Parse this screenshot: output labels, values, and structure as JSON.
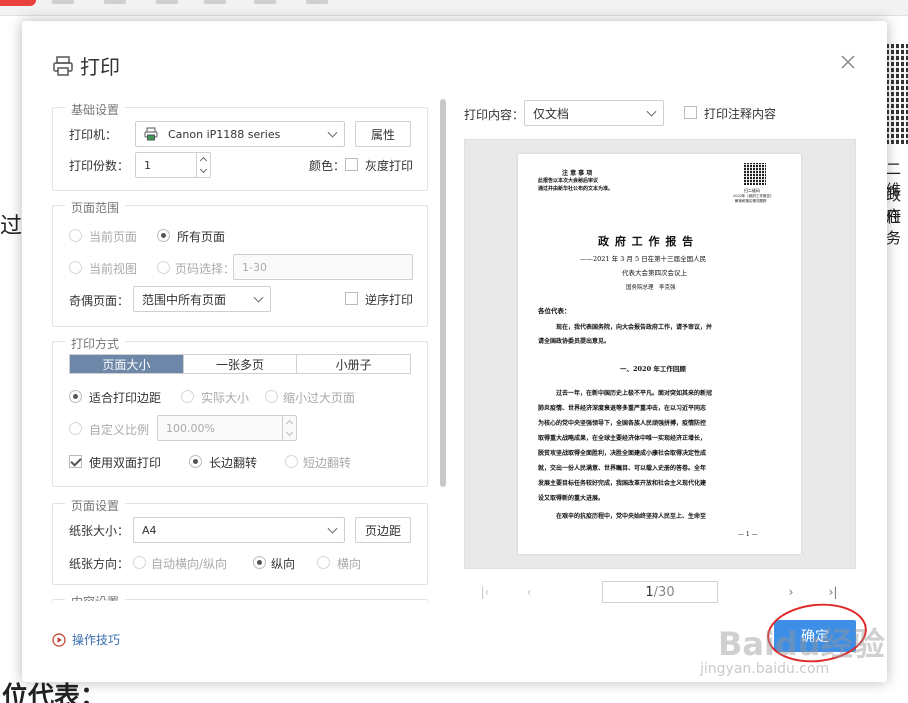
{
  "background": {
    "left_char": "过",
    "right_lines": [
      "二维",
      "政府",
      "任务"
    ],
    "bottom_text": "位代表："
  },
  "dialog": {
    "title": "打印",
    "basic": {
      "legend": "基础设置",
      "printer_label": "打印机：",
      "printer_value": "Canon iP1188 series",
      "properties_button": "属性",
      "copies_label": "打印份数：",
      "copies_value": "1",
      "color_label": "颜色：",
      "grayscale_label": "灰度打印",
      "grayscale_checked": false
    },
    "range": {
      "legend": "页面范围",
      "current_page": "当前页面",
      "all_pages": "所有页面",
      "current_view": "当前视图",
      "page_select": "页码选择：",
      "page_select_placeholder": "1-30",
      "odd_even_label": "奇偶页面：",
      "odd_even_value": "范围中所有页面",
      "reverse_label": "逆序打印",
      "selected": "all_pages"
    },
    "mode": {
      "legend": "打印方式",
      "tabs": [
        "页面大小",
        "一张多页",
        "小册子"
      ],
      "active_tab": "页面大小",
      "fit_margin": "适合打印边距",
      "actual_size": "实际大小",
      "shrink_large": "缩小过大页面",
      "custom_scale": "自定义比例",
      "scale_value": "100.00%",
      "duplex_label": "使用双面打印",
      "duplex_checked": true,
      "long_edge": "长边翻转",
      "short_edge": "短边翻转"
    },
    "page_setup": {
      "legend": "页面设置",
      "paper_size_label": "纸张大小：",
      "paper_size_value": "A4",
      "margin_button": "页边距",
      "orientation_label": "纸张方向：",
      "auto": "自动横向/纵向",
      "portrait": "纵向",
      "landscape": "横向",
      "selected": "portrait"
    },
    "content": {
      "legend": "内容设置"
    },
    "tips_link": "操作技巧",
    "print_content_label": "打印内容：",
    "print_content_value": "仅文档",
    "print_comments_label": "打印注释内容",
    "pager": {
      "current": "1",
      "total": "/30"
    },
    "ok_button": "确定"
  },
  "preview": {
    "notice_title": "注 意 事 项",
    "notice_1": "此报告以本次大会秘后审议",
    "notice_2": "通过并由新华社公布的文本为准。",
    "qr_caption_1": "扫二维码",
    "qr_caption_2": "2020年《政府工作报告》",
    "qr_caption_3": "解读和落实情况跟踪",
    "doc_title": "政 府 工 作 报 告",
    "subtitle_1": "——2021 年 3 月 5 日在第十三届全国人民",
    "subtitle_2": "代表大会第四次会议上",
    "author": "国务院总理　李克强",
    "greeting": "各位代表：",
    "para1_1": "现在，我代表国务院，向大会报告政府工作，请予审议，并",
    "para1_2": "请全国政协委员提出意见。",
    "section": "一、2020 年工作回顾",
    "body": [
      "过去一年，在新中国历史上极不平凡。面对突如其来的新冠",
      "肺炎疫情、世界经济深度衰退等多重严重冲击，在以习近平同志",
      "为核心的党中央坚强领导下，全国各族人民顽强拼搏，疫情防控",
      "取得重大战略成果，在全球主要经济体中唯一实现经济正增长，",
      "脱贫攻坚战取得全面胜利，决胜全面建成小康社会取得决定性成",
      "就，交出一份人民满意、世界瞩目、可以载入史册的答卷。全年",
      "发展主要目标任务较好完成，我国改革开放和社会主义现代化建",
      "设又取得新的重大进展。",
      "在艰辛的抗疫历程中，党中央始终坚持人民至上、生命至"
    ],
    "page_num": "— 1 —"
  },
  "watermark": {
    "brand": "Baidu经验",
    "url": "jingyan.baidu.com"
  },
  "colors": {
    "accent": "#3d8ee6",
    "tab_active": "#6d87a8",
    "circle": "#e02a2a"
  }
}
